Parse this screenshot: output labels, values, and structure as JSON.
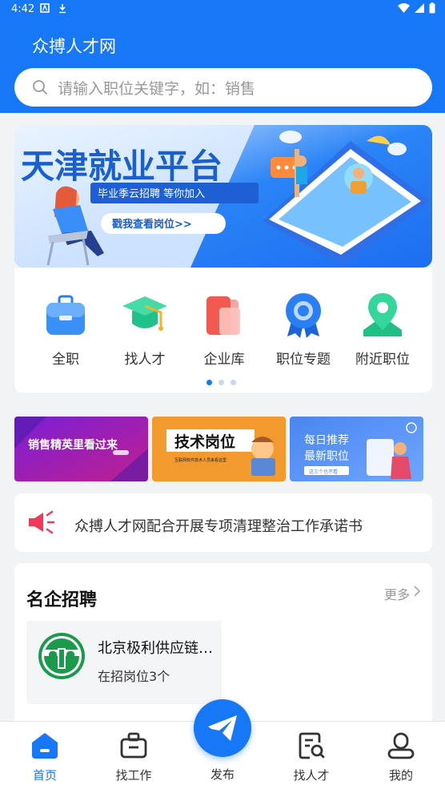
{
  "status_bar": {
    "time": "4:42"
  },
  "header": {
    "title": "众搏人才网",
    "search_placeholder": "请输入职位关键字，如：销售"
  },
  "banner": {
    "headline": "天津就业平台",
    "subline": "毕业季云招聘 等你加入",
    "cta": "戳我查看岗位>>"
  },
  "categories": [
    {
      "label": "全职",
      "icon": "briefcase-icon"
    },
    {
      "label": "找人才",
      "icon": "graduation-cap-icon"
    },
    {
      "label": "企业库",
      "icon": "company-library-icon"
    },
    {
      "label": "职位专题",
      "icon": "badge-icon"
    },
    {
      "label": "附近职位",
      "icon": "location-pin-icon"
    }
  ],
  "promos": [
    {
      "text": "销售精英里看过来"
    },
    {
      "text": "技术岗位",
      "sub": "互联网软件技术人员来看这里"
    },
    {
      "text1": "每日推荐",
      "text2": "最新职位",
      "tag": "这三个也不看"
    }
  ],
  "notice": {
    "text": "众搏人才网配合开展专项清理整治工作承诺书"
  },
  "famous": {
    "title": "名企招聘",
    "more": "更多",
    "companies": [
      {
        "name": "北京极利供应链管理有限公司",
        "jobs": "在招岗位3个"
      }
    ]
  },
  "tabbar": {
    "home": "首页",
    "jobs": "找工作",
    "publish": "发布",
    "talent": "找人才",
    "mine": "我的"
  },
  "colors": {
    "primary": "#1677f7",
    "notice_red": "#f03a5a"
  }
}
